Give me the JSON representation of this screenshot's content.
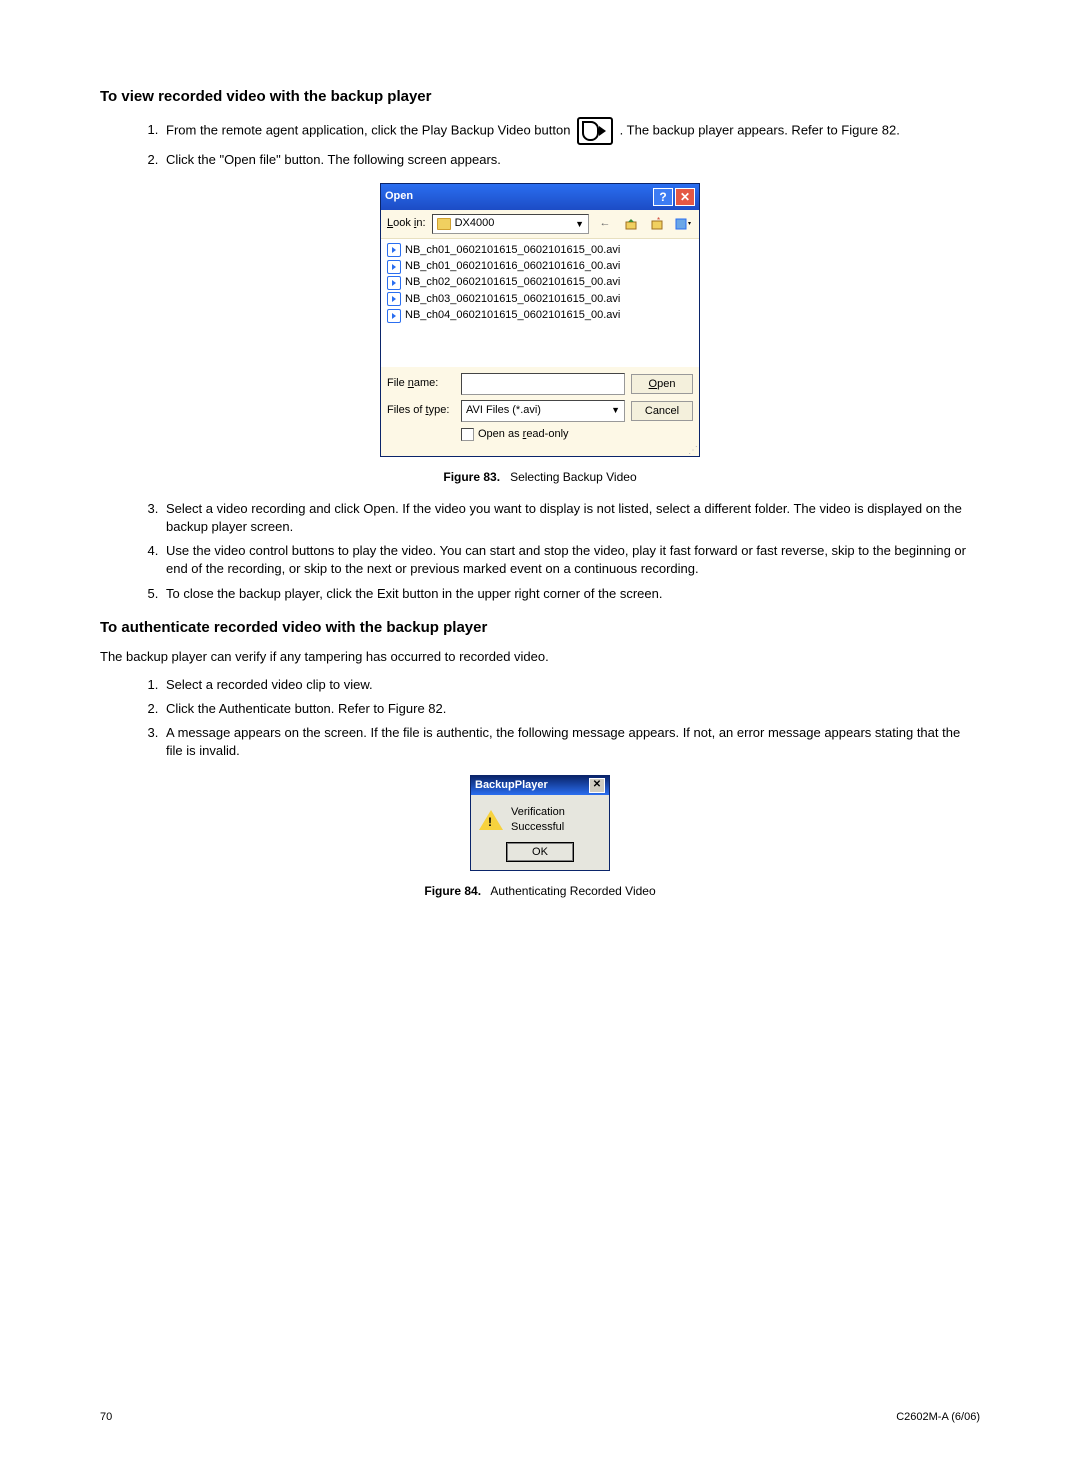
{
  "section1": {
    "heading": "To view recorded video with the backup player",
    "step1a": "From the remote agent application, click the Play Backup Video button ",
    "step1b": " . The backup player appears. Refer to Figure 82.",
    "step2": "Click the \"Open file\" button. The following screen appears.",
    "step3": "Select a video recording and click Open. If the video you want to display is not listed, select a different folder. The video is displayed on the backup player screen.",
    "step4": "Use the video control buttons to play the video. You can start and stop the video, play it fast forward or fast reverse, skip to the beginning or end of the recording, or skip to the next or previous marked event on a continuous recording.",
    "step5": "To close the backup player, click the Exit button in the upper right corner of the screen."
  },
  "fig83": {
    "label": "Figure 83.",
    "desc": "Selecting Backup Video"
  },
  "open_dialog": {
    "title": "Open",
    "lookin_label": "Look in:",
    "folder_name": "DX4000",
    "files": [
      "NB_ch01_0602101615_0602101615_00.avi",
      "NB_ch01_0602101616_0602101616_00.avi",
      "NB_ch02_0602101615_0602101615_00.avi",
      "NB_ch03_0602101615_0602101615_00.avi",
      "NB_ch04_0602101615_0602101615_00.avi"
    ],
    "filename_label": "File name:",
    "filename_value": "",
    "filetype_label": "Files of type:",
    "filetype_value": "AVI Files (*.avi)",
    "readonly_label": "Open as read-only",
    "open_btn": "Open",
    "cancel_btn": "Cancel"
  },
  "section2": {
    "heading": "To authenticate recorded video with the backup player",
    "intro": "The backup player can verify if any tampering has occurred to recorded video.",
    "step1": "Select a recorded video clip to view.",
    "step2": "Click the Authenticate button. Refer to Figure 82.",
    "step3": "A message appears on the screen. If the file is authentic, the following message appears. If not, an error message appears stating that the file is invalid."
  },
  "bp_dialog": {
    "title": "BackupPlayer",
    "msg": "Verification Successful",
    "ok": "OK"
  },
  "fig84": {
    "label": "Figure 84.",
    "desc": "Authenticating Recorded Video"
  },
  "footer": {
    "page": "70",
    "doc": "C2602M-A (6/06)"
  }
}
